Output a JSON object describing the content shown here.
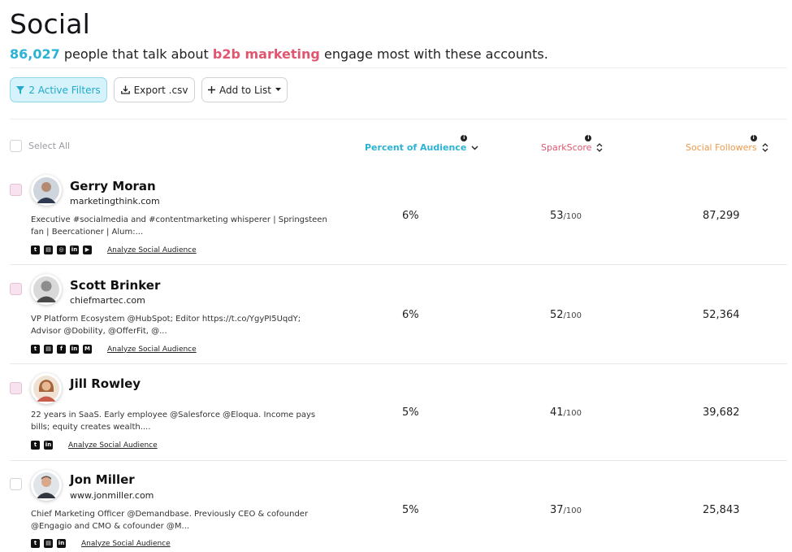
{
  "page": {
    "title": "Social",
    "summary": {
      "count": "86,027",
      "text_before_topic": "people that talk about",
      "topic": "b2b marketing",
      "text_after_topic": "engage most with these accounts."
    }
  },
  "toolbar": {
    "filters_label": "2 Active Filters",
    "export_label": "Export .csv",
    "add_to_list_label": "Add to List"
  },
  "table": {
    "select_all_label": "Select All",
    "columns": {
      "percent": "Percent of Audience",
      "spark": "SparkScore",
      "followers": "Social Followers"
    },
    "rows": [
      {
        "name": "Gerry Moran",
        "site": "marketingthink.com",
        "bio": "Executive #socialmedia and #contentmarketing whisperer | Springsteen fan | Beercationer | Alum:...",
        "socials": [
          "twitter-icon",
          "website-icon",
          "instagram-icon",
          "linkedin-icon",
          "youtube-icon"
        ],
        "analyze": "Analyze Social Audience",
        "percent": "6%",
        "spark": "53",
        "spark_max": "/100",
        "followers": "87,299"
      },
      {
        "name": "Scott Brinker",
        "site": "chiefmartec.com",
        "bio": "VP Platform Ecosystem @HubSpot; Editor https://t.co/YgyPI5UqdY; Advisor @Dobility, @OfferFit, @...",
        "socials": [
          "twitter-icon",
          "website-icon",
          "facebook-icon",
          "linkedin-icon",
          "medium-icon"
        ],
        "analyze": "Analyze Social Audience",
        "percent": "6%",
        "spark": "52",
        "spark_max": "/100",
        "followers": "52,364"
      },
      {
        "name": "Jill Rowley",
        "site": "",
        "bio": "22 years in SaaS. Early employee @Salesforce @Eloqua. Income pays bills; equity creates wealth....",
        "socials": [
          "twitter-icon",
          "linkedin-icon"
        ],
        "analyze": "Analyze Social Audience",
        "percent": "5%",
        "spark": "41",
        "spark_max": "/100",
        "followers": "39,682"
      },
      {
        "name": "Jon Miller",
        "site": "www.jonmiller.com",
        "bio": "Chief Marketing Officer @Demandbase. Previously CEO & cofounder @Engagio and CMO & cofounder @M...",
        "socials": [
          "twitter-icon",
          "website-icon",
          "linkedin-icon"
        ],
        "analyze": "Analyze Social Audience",
        "percent": "5%",
        "spark": "37",
        "spark_max": "/100",
        "followers": "25,843"
      }
    ]
  },
  "colors": {
    "accent_blue": "#2bb2d4",
    "accent_pink": "#e0566f",
    "accent_orange": "#f2994a"
  }
}
